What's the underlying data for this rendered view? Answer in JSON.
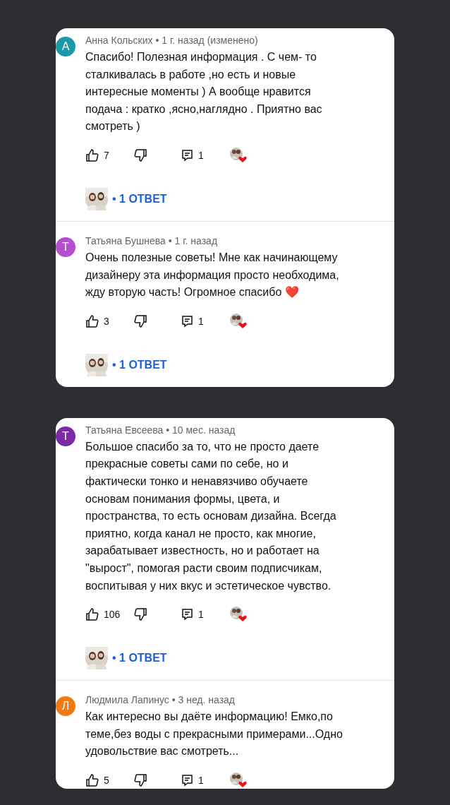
{
  "cards": [
    {
      "comments": [
        {
          "avatar_letter": "А",
          "color": "#1a9aa8",
          "meta": "Анна Кольских • 1 г. назад (изменено)",
          "text": "Спасибо! Полезная информация . С чем- то\nсталкивалась в работе ,но есть и новые\nинтересные моменты ) А вообще нравится\nподача : кратко ,ясно,наглядно . Приятно вас\nсмотреть )",
          "likes": "7",
          "comments_count": "1",
          "replies": "• 1 ОТВЕТ"
        },
        {
          "avatar_letter": "Т",
          "color": "#b44fcf",
          "meta": "Татьяна Бушнева • 1 г. назад",
          "text": "Очень полезные советы! Мне как начинающему\nдизайнеру эта информация просто необходима,\nжду вторую часть! Огромное спасибо ❤️",
          "likes": "3",
          "comments_count": "1",
          "replies": "• 1 ОТВЕТ"
        }
      ]
    },
    {
      "comments": [
        {
          "avatar_letter": "Т",
          "color": "#7b2aa6",
          "meta": "Татьяна Евсеева • 10 мес. назад",
          "text": "Большое спасибо за то, что не просто даете\nпрекрасные советы сами по себе, но и\nфактически тонко и ненавязчиво обучаете\nосновам понимания формы, цвета, и\nпространства, то есть основам дизайна. Всегда\nприятно, когда канал не просто, как многие,\nзарабатывает известность, но и работает на\n\"вырост\", помогая расти своим подписчикам,\nвоспитывая у них вкус и эстетическое чувство.",
          "likes": "106",
          "comments_count": "1",
          "replies": "• 1 ОТВЕТ"
        },
        {
          "avatar_letter": "Л",
          "color": "#ef7b12",
          "meta": "Людмила Лапинус • 3 нед. назад",
          "text": "Как интересно вы даёте информацию! Емко,по\nтеме,без воды с прекрасными примерами...Одно\nудовольствие вас смотреть...",
          "likes": "5",
          "comments_count": "1"
        }
      ]
    }
  ]
}
